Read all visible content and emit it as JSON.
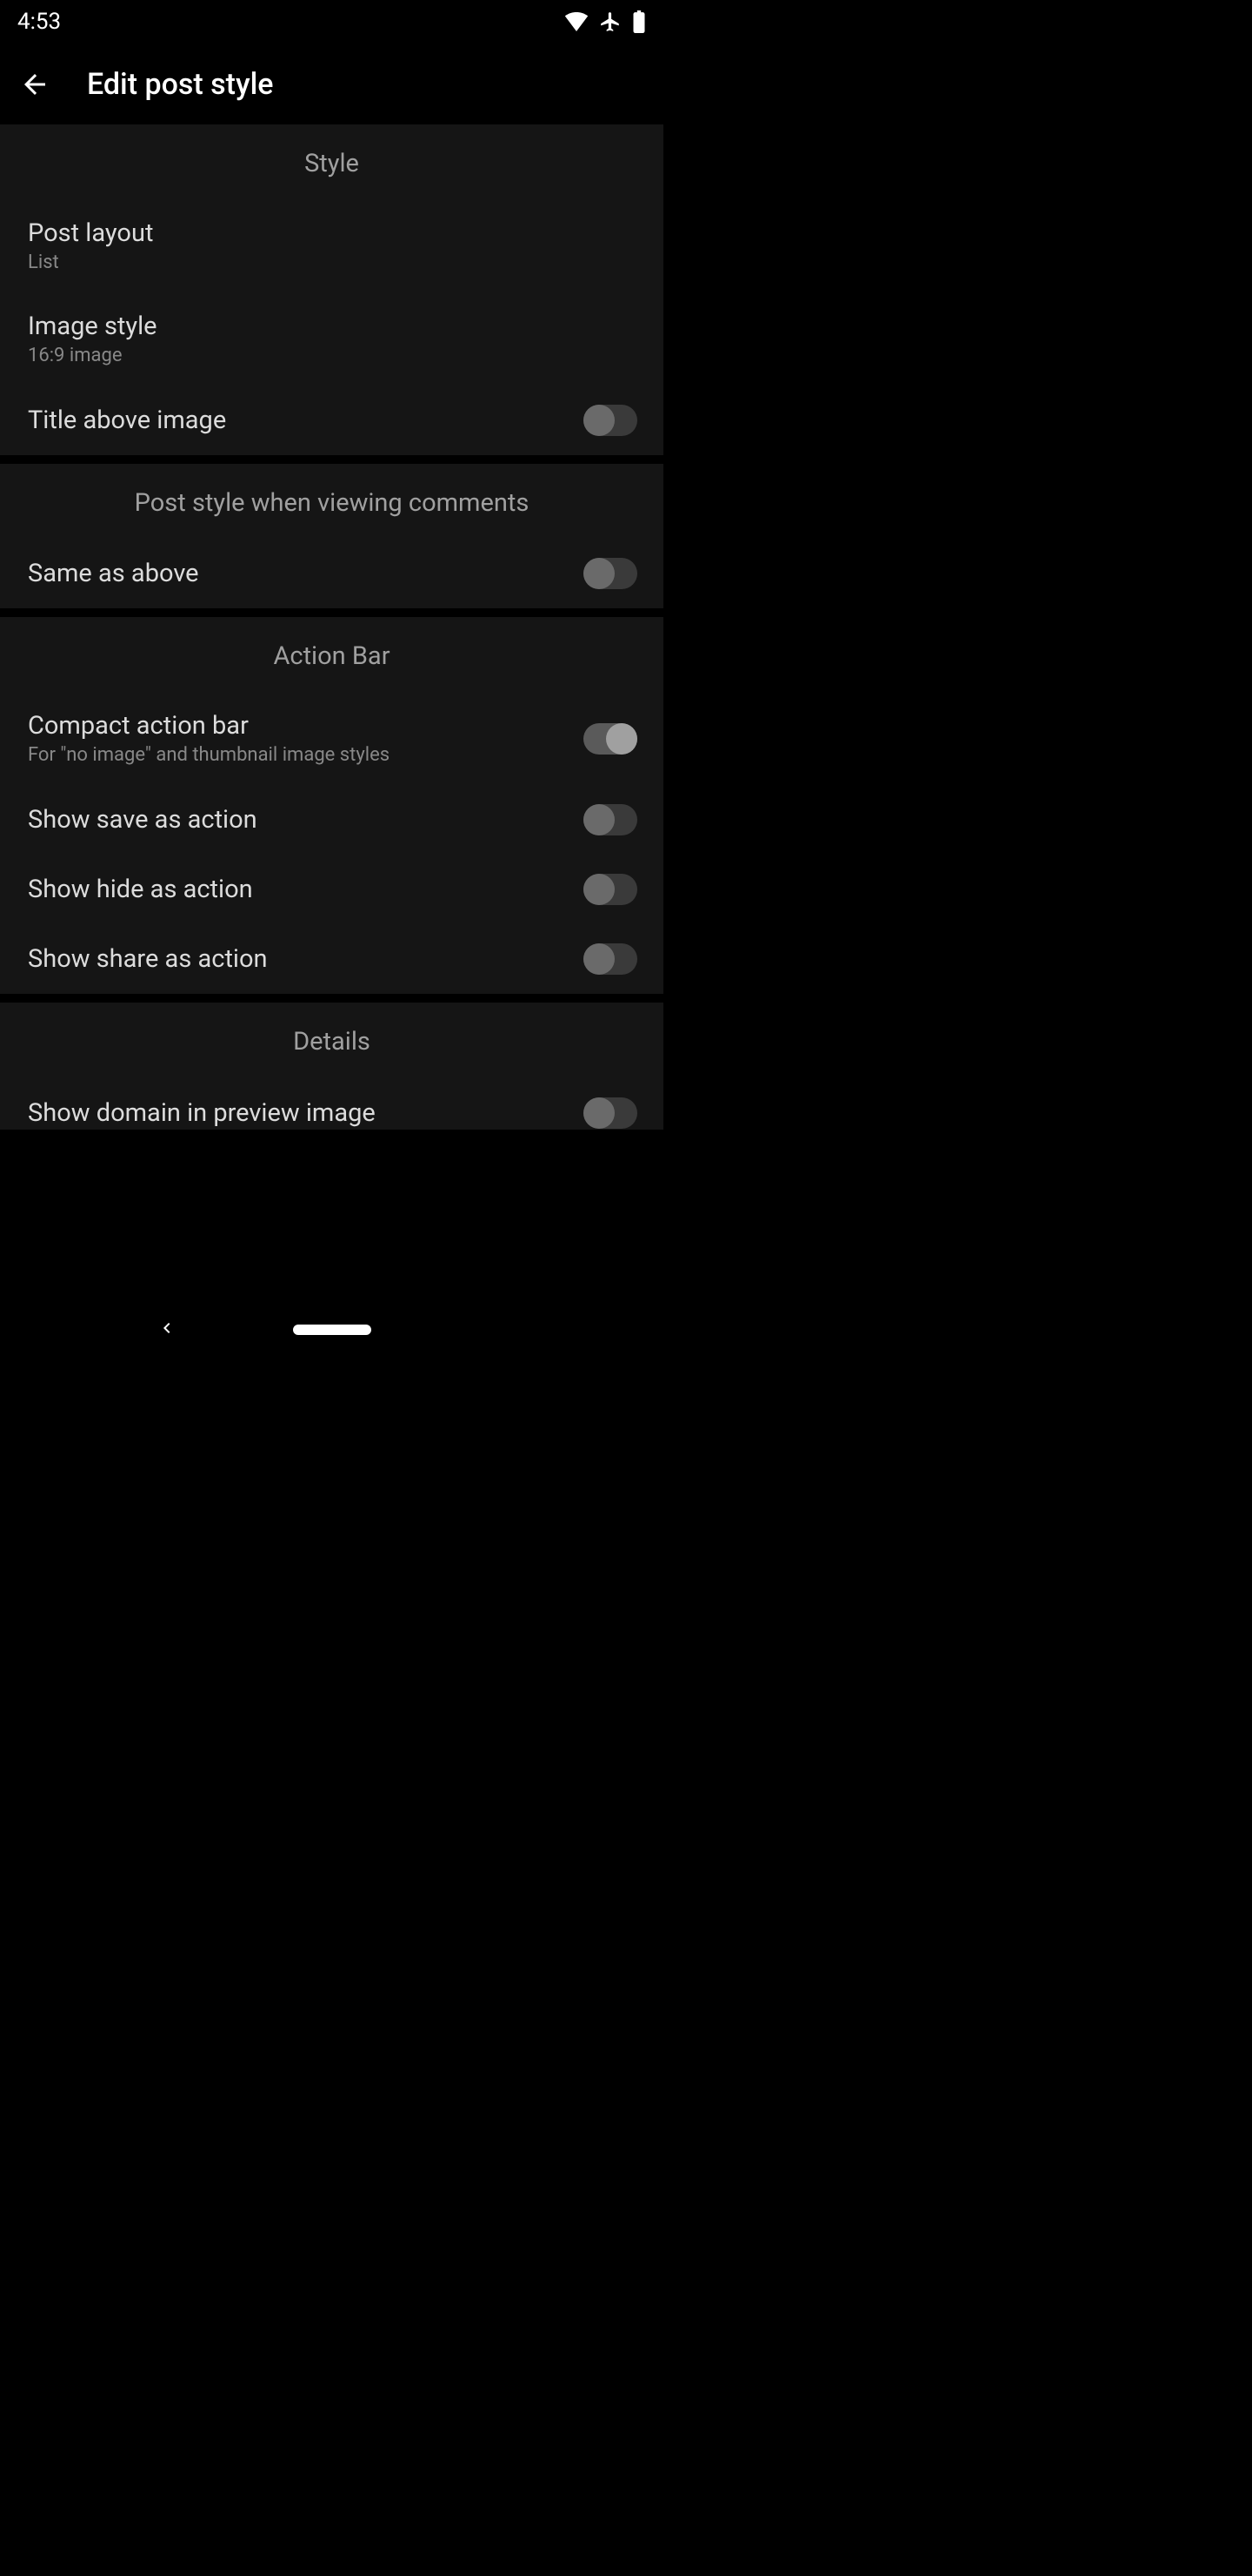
{
  "status": {
    "time": "4:53"
  },
  "header": {
    "title": "Edit post style"
  },
  "sections": {
    "style": {
      "header": "Style",
      "post_layout": {
        "title": "Post layout",
        "value": "List"
      },
      "image_style": {
        "title": "Image style",
        "value": "16:9 image"
      },
      "title_above_image": {
        "title": "Title above image",
        "on": false
      }
    },
    "comments_view": {
      "header": "Post style when viewing comments",
      "same_as_above": {
        "title": "Same as above",
        "on": false
      }
    },
    "action_bar": {
      "header": "Action Bar",
      "compact": {
        "title": "Compact action bar",
        "subtitle": "For \"no image\" and thumbnail image styles",
        "on": true
      },
      "show_save": {
        "title": "Show save as action",
        "on": false
      },
      "show_hide": {
        "title": "Show hide as action",
        "on": false
      },
      "show_share": {
        "title": "Show share as action",
        "on": false
      }
    },
    "details": {
      "header": "Details",
      "show_domain": {
        "title": "Show domain in preview image",
        "on": false
      }
    }
  }
}
